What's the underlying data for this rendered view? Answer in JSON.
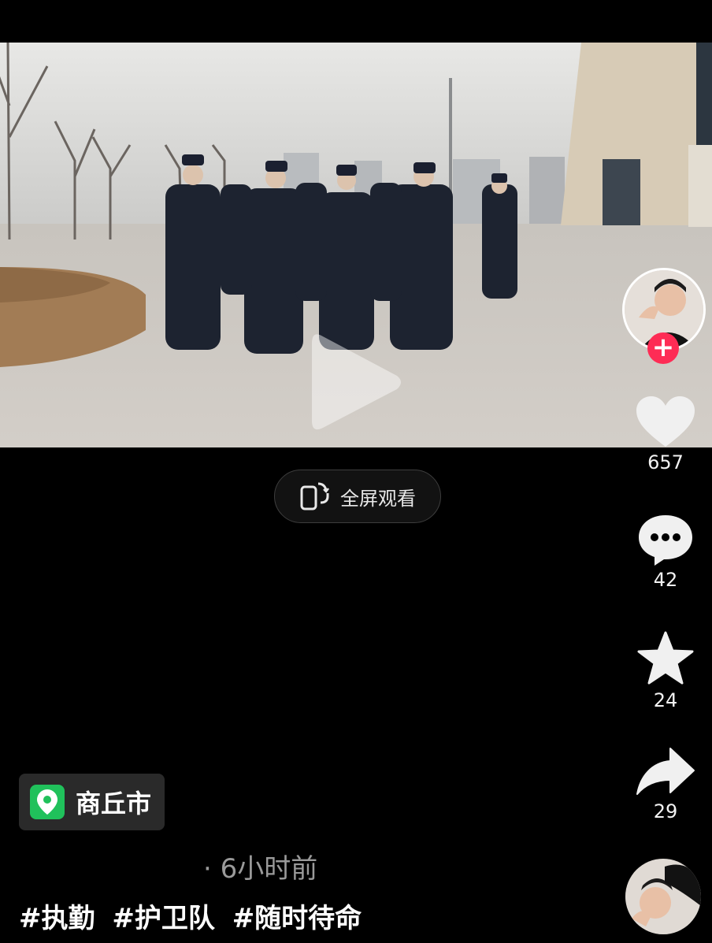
{
  "video": {
    "play_icon": "play-icon"
  },
  "fullscreen": {
    "label": "全屏观看",
    "icon": "rotate-screen-icon"
  },
  "author": {
    "avatar_icon": "author-avatar",
    "follow_symbol": "+"
  },
  "actions": {
    "like": {
      "icon": "heart-icon",
      "count": "657"
    },
    "comment": {
      "icon": "comment-icon",
      "count": "42"
    },
    "favorite": {
      "icon": "star-icon",
      "count": "24"
    },
    "share": {
      "icon": "share-icon",
      "count": "29"
    }
  },
  "location": {
    "icon": "location-pin-icon",
    "name": "商丘市",
    "accent": "#20c15b"
  },
  "post": {
    "time": "· 6小时前",
    "hashtags": [
      "#执勤",
      "#护卫队",
      "#随时待命"
    ]
  },
  "colors": {
    "follow": "#fe2c55",
    "background": "#000000"
  }
}
